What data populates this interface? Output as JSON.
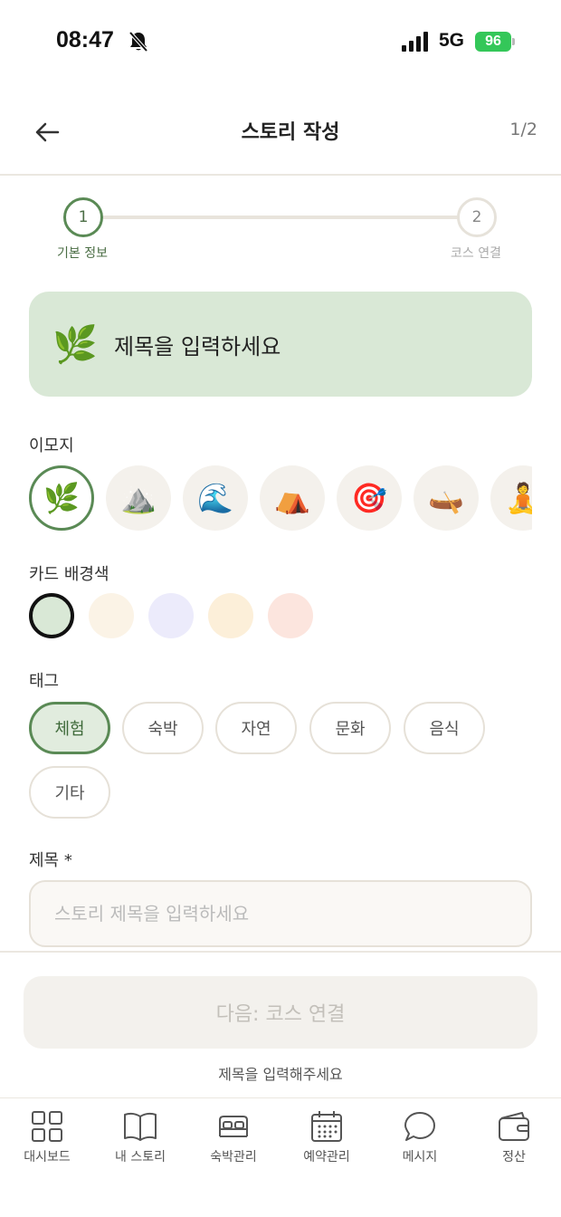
{
  "status_bar": {
    "time": "08:47",
    "network": "5G",
    "battery": "96"
  },
  "header": {
    "title": "스토리 작성",
    "step_count": "1/2"
  },
  "stepper": {
    "steps": [
      {
        "number": "1",
        "label": "기본 정보",
        "state": "active"
      },
      {
        "number": "2",
        "label": "코스 연결",
        "state": "inactive"
      }
    ]
  },
  "preview": {
    "emoji": "🌿",
    "title": "제목을 입력하세요"
  },
  "emoji_section": {
    "label": "이모지",
    "options": [
      "🌿",
      "⛰️",
      "🌊",
      "⛺",
      "🎯",
      "🛶",
      "🧘"
    ],
    "selected": "🌿"
  },
  "color_section": {
    "label": "카드 배경색",
    "options": [
      "#d9e8d6",
      "#fbf3e6",
      "#ecebfb",
      "#fcefd9",
      "#fce5de"
    ],
    "selected": "#d9e8d6"
  },
  "tag_section": {
    "label": "태그",
    "tags": [
      "체험",
      "숙박",
      "자연",
      "문화",
      "음식",
      "기타"
    ],
    "selected": "체험"
  },
  "title_field": {
    "label": "제목 *",
    "placeholder": "스토리 제목을 입력하세요",
    "value": ""
  },
  "footer": {
    "next_button": "다음: 코스 연결",
    "hint": "제목을 입력해주세요"
  },
  "tabbar": {
    "tabs": [
      {
        "label": "대시보드",
        "icon": "grid-icon"
      },
      {
        "label": "내 스토리",
        "icon": "book-icon"
      },
      {
        "label": "숙박관리",
        "icon": "bed-icon"
      },
      {
        "label": "예약관리",
        "icon": "calendar-icon"
      },
      {
        "label": "메시지",
        "icon": "chat-icon"
      },
      {
        "label": "정산",
        "icon": "wallet-icon"
      }
    ]
  },
  "colors": {
    "accent": "#5a8a55",
    "accent_bg": "#d9e8d6",
    "border": "#e6e1d8",
    "battery": "#34c759"
  }
}
